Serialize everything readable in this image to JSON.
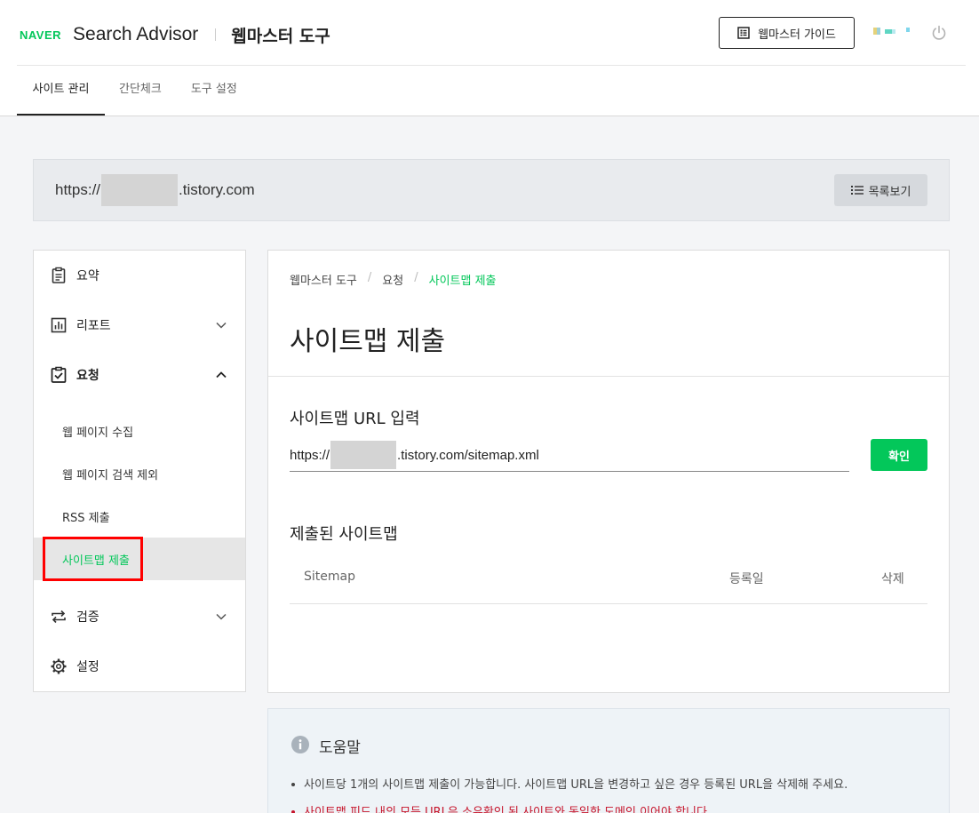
{
  "header": {
    "logo": "NAVER",
    "product": "Search Advisor",
    "tool": "웹마스터 도구",
    "guide_button": "웹마스터 가이드"
  },
  "tabs": [
    {
      "label": "사이트 관리",
      "active": true
    },
    {
      "label": "간단체크",
      "active": false
    },
    {
      "label": "도구 설정",
      "active": false
    }
  ],
  "site": {
    "url_prefix": "https://",
    "url_suffix": ".tistory.com",
    "list_button": "목록보기"
  },
  "sidebar": {
    "items": [
      {
        "label": "요약",
        "icon": "clipboard-icon"
      },
      {
        "label": "리포트",
        "icon": "bar-chart-icon",
        "expanded": false
      },
      {
        "label": "요청",
        "icon": "clipboard-check-icon",
        "expanded": true
      },
      {
        "label": "검증",
        "icon": "repeat-arrows-icon",
        "expanded": false
      },
      {
        "label": "설정",
        "icon": "gear-icon"
      }
    ],
    "subitems": [
      {
        "label": "웹 페이지 수집",
        "active": false
      },
      {
        "label": "웹 페이지 검색 제외",
        "active": false
      },
      {
        "label": "RSS 제출",
        "active": false
      },
      {
        "label": "사이트맵 제출",
        "active": true
      }
    ]
  },
  "main": {
    "breadcrumb": [
      "웹마스터 도구",
      "요청",
      "사이트맵 제출"
    ],
    "title": "사이트맵 제출",
    "input_section": "사이트맵 URL 입력",
    "input_prefix": "https://",
    "input_suffix": ".tistory.com/sitemap.xml",
    "confirm_button": "확인",
    "submitted_section": "제출된 사이트맵",
    "table_columns": [
      "Sitemap",
      "등록일",
      "삭제"
    ]
  },
  "help": {
    "title": "도움말",
    "lines": [
      "사이트당 1개의 사이트맵 제출이 가능합니다. 사이트맵 URL을 변경하고 싶은 경우 등록된 URL을 삭제해 주세요.",
      "사이트맵 피드 내의 모든 URL은 소유확인 된 사이트와 동일한 도메인 이어야 합니다."
    ]
  },
  "colors": {
    "accent": "#03c75a",
    "warning": "#c6142b",
    "highlight": "#ff0000"
  }
}
